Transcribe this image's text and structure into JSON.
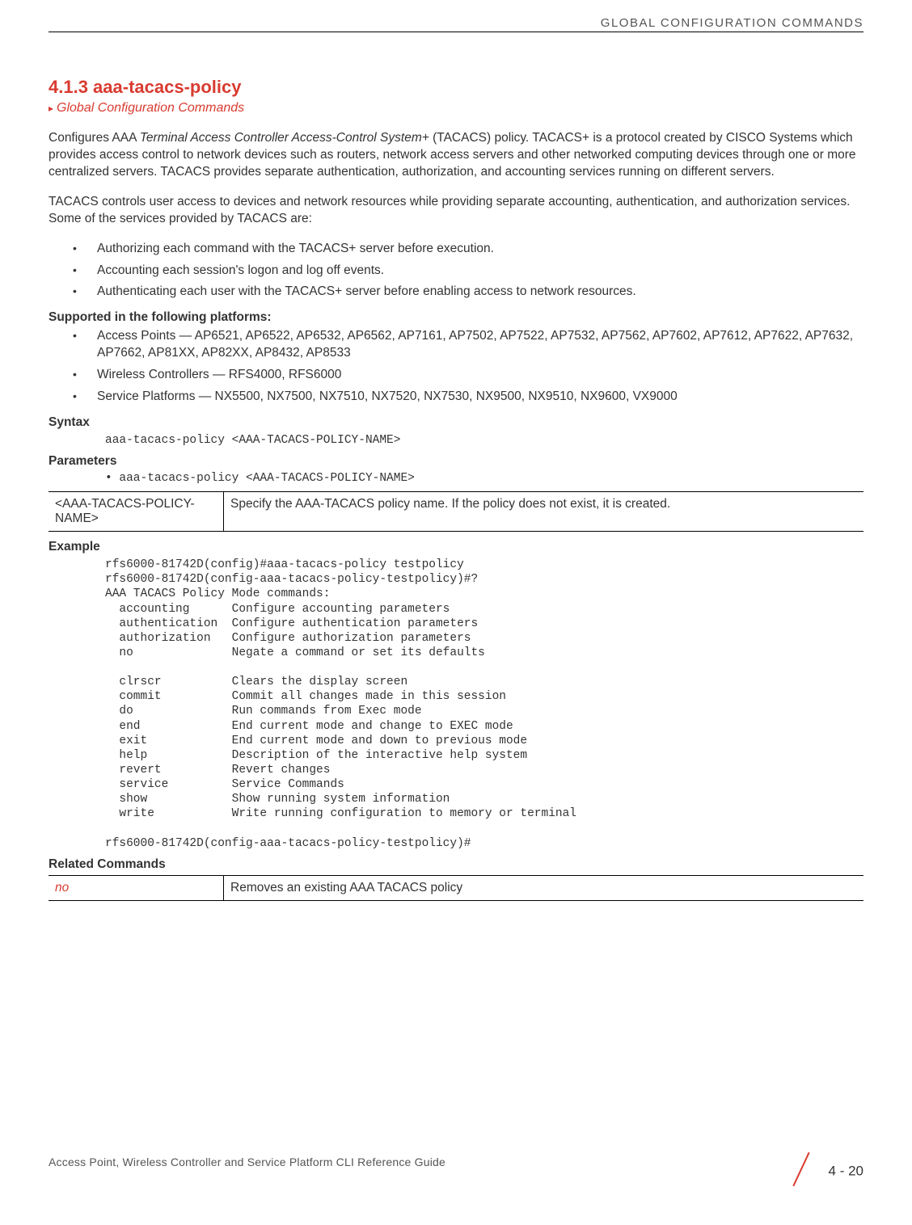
{
  "header": "GLOBAL CONFIGURATION COMMANDS",
  "section_number": "4.1.3 aaa-tacacs-policy",
  "breadcrumb": "Global Configuration Commands",
  "para1_a": "Configures AAA ",
  "para1_em": "Terminal Access Controller Access-Control System+",
  "para1_b": " (TACACS) policy. TACACS+ is a protocol created by CISCO Systems which provides access control to network devices such as routers, network access servers and other networked computing devices through one or more centralized servers. TACACS provides separate authentication, authorization, and accounting services running on different servers.",
  "para2": "TACACS controls user access to devices and network resources while providing separate accounting, authentication, and authorization services. Some of the services provided by TACACS are:",
  "services": [
    "Authorizing each command with the TACACS+ server before execution.",
    "Accounting each session's logon and log off events.",
    "Authenticating each user with the TACACS+ server before enabling access to network resources."
  ],
  "supported_head": "Supported in the following platforms:",
  "supported": [
    "Access Points — AP6521, AP6522, AP6532, AP6562, AP7161, AP7502, AP7522, AP7532, AP7562, AP7602, AP7612, AP7622, AP7632, AP7662, AP81XX, AP82XX, AP8432, AP8533",
    "Wireless Controllers — RFS4000, RFS6000",
    "Service Platforms — NX5500, NX7500, NX7510, NX7520, NX7530, NX9500, NX9510, NX9600, VX9000"
  ],
  "syntax_head": "Syntax",
  "syntax_code": "aaa-tacacs-policy <AAA-TACACS-POLICY-NAME>",
  "params_head": "Parameters",
  "params_bullet": "• aaa-tacacs-policy <AAA-TACACS-POLICY-NAME>",
  "param_table": {
    "name": "<AAA-TACACS-POLICY-NAME>",
    "desc": "Specify the AAA-TACACS policy name. If the policy does not exist, it is created."
  },
  "example_head": "Example",
  "example_code": "rfs6000-81742D(config)#aaa-tacacs-policy testpolicy\nrfs6000-81742D(config-aaa-tacacs-policy-testpolicy)#?\nAAA TACACS Policy Mode commands:\n  accounting      Configure accounting parameters\n  authentication  Configure authentication parameters\n  authorization   Configure authorization parameters\n  no              Negate a command or set its defaults\n\n  clrscr          Clears the display screen\n  commit          Commit all changes made in this session\n  do              Run commands from Exec mode\n  end             End current mode and change to EXEC mode\n  exit            End current mode and down to previous mode\n  help            Description of the interactive help system\n  revert          Revert changes\n  service         Service Commands\n  show            Show running system information\n  write           Write running configuration to memory or terminal\n\nrfs6000-81742D(config-aaa-tacacs-policy-testpolicy)#",
  "related_head": "Related Commands",
  "related_table": {
    "cmd": "no",
    "desc": "Removes an existing AAA TACACS policy"
  },
  "footer_left": "Access Point, Wireless Controller and Service Platform CLI Reference Guide",
  "footer_right": "4 - 20"
}
